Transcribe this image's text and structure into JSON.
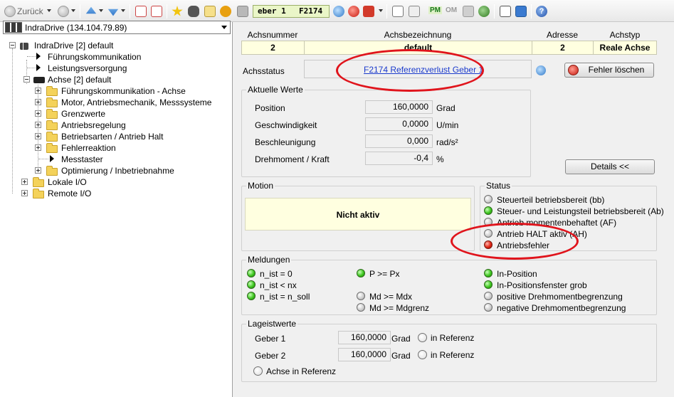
{
  "toolbar": {
    "back_label": "Zurück",
    "code_left": "eber 1",
    "code_right": "F2174",
    "pm_label": "PM",
    "om_label": "OM"
  },
  "tree": {
    "drive_select": "IndraDrive (134.104.79.89)",
    "items": [
      {
        "label": "IndraDrive [2] default"
      },
      {
        "label": "Führungskommunikation"
      },
      {
        "label": "Leistungsversorgung"
      },
      {
        "label": "Achse [2] default"
      },
      {
        "label": "Führungskommunikation - Achse"
      },
      {
        "label": "Motor, Antriebsmechanik, Messsysteme"
      },
      {
        "label": "Grenzwerte"
      },
      {
        "label": "Antriebsregelung"
      },
      {
        "label": "Betriebsarten / Antrieb Halt"
      },
      {
        "label": "Fehlerreaktion"
      },
      {
        "label": "Messtaster"
      },
      {
        "label": "Optimierung / Inbetriebnahme"
      },
      {
        "label": "Lokale I/O"
      },
      {
        "label": "Remote I/O"
      }
    ]
  },
  "header": {
    "col_achsnummer": "Achsnummer",
    "col_achsbezeichnung": "Achsbezeichnung",
    "col_adresse": "Adresse",
    "col_achstyp": "Achstyp",
    "achsnummer": "2",
    "achsbezeichnung": "default",
    "adresse": "2",
    "achstyp": "Reale Achse"
  },
  "achsstatus": {
    "label": "Achsstatus",
    "link": "F2174 Referenzverlust Geber 1",
    "clear_button": "Fehler löschen"
  },
  "aktuelle_werte": {
    "title": "Aktuelle Werte",
    "rows": [
      {
        "label": "Position",
        "value": "160,0000",
        "unit": "Grad"
      },
      {
        "label": "Geschwindigkeit",
        "value": "0,0000",
        "unit": "U/min"
      },
      {
        "label": "Beschleunigung",
        "value": "0,000",
        "unit": "rad/s²"
      },
      {
        "label": "Drehmoment / Kraft",
        "value": "-0,4",
        "unit": "%"
      }
    ],
    "details_button": "Details <<"
  },
  "motion": {
    "title": "Motion",
    "text": "Nicht aktiv"
  },
  "status": {
    "title": "Status",
    "items": [
      {
        "label": "Steuerteil betriebsbereit (bb)",
        "state": "gray"
      },
      {
        "label": "Steuer- und Leistungsteil betriebsbereit (Ab)",
        "state": "green"
      },
      {
        "label": "Antrieb momentenbehaftet (AF)",
        "state": "gray"
      },
      {
        "label": "Antrieb HALT aktiv (AH)",
        "state": "gray"
      },
      {
        "label": "Antriebsfehler",
        "state": "red"
      }
    ]
  },
  "meldungen": {
    "title": "Meldungen",
    "col1": [
      {
        "label": "n_ist = 0",
        "state": "green"
      },
      {
        "label": "n_ist < nx",
        "state": "green"
      },
      {
        "label": "n_ist = n_soll",
        "state": "green"
      }
    ],
    "col2": [
      {
        "label": "P >= Px",
        "state": "green"
      },
      {
        "label": "Md >= Mdx",
        "state": "gray"
      },
      {
        "label": "Md >= Mdgrenz",
        "state": "gray"
      }
    ],
    "col3": [
      {
        "label": "In-Position",
        "state": "green"
      },
      {
        "label": "In-Positionsfenster grob",
        "state": "green"
      },
      {
        "label": "positive Drehmomentbegrenzung",
        "state": "gray"
      },
      {
        "label": "negative Drehmomentbegrenzung",
        "state": "gray"
      }
    ]
  },
  "lageistwerte": {
    "title": "Lageistwerte",
    "rows": [
      {
        "label": "Geber 1",
        "value": "160,0000",
        "unit": "Grad",
        "ref": "in Referenz"
      },
      {
        "label": "Geber 2",
        "value": "160,0000",
        "unit": "Grad",
        "ref": "in Referenz"
      }
    ],
    "achse_ref": "Achse in Referenz"
  },
  "colors": {
    "annotation": "#e0141c",
    "highlight_field": "#ffffe0",
    "led_green": "#3ec61f",
    "led_red": "#e02414"
  }
}
